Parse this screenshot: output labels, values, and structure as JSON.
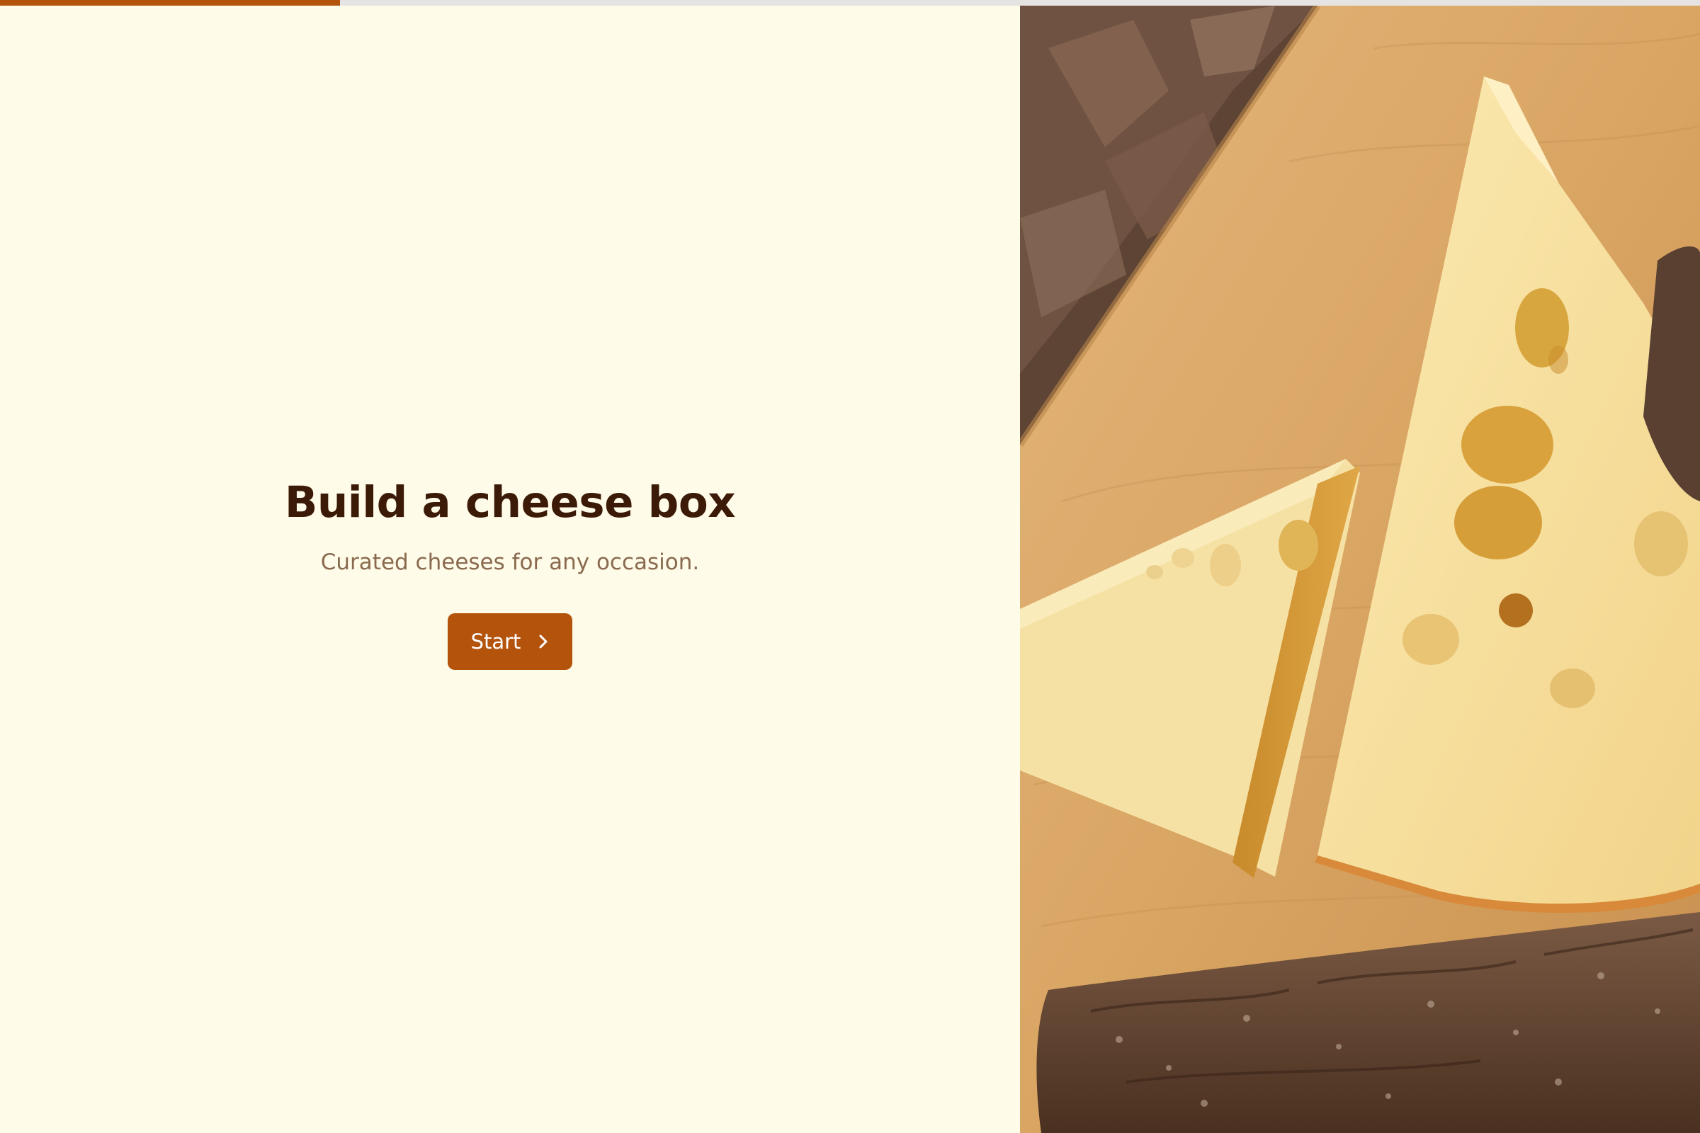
{
  "progress": {
    "value": 0.2
  },
  "hero": {
    "title": "Build a cheese box",
    "subtitle": "Curated cheeses for any occasion.",
    "start_label": "Start",
    "start_icon": "chevron-right-icon"
  },
  "image": {
    "subject": "cheese wedges on wooden board with bread"
  },
  "colors": {
    "background": "#FEFBE8",
    "accent": "#B4540C",
    "title": "#3B1A07",
    "subtitle": "#8A6A4F",
    "progress_track": "#E6E4E2"
  }
}
